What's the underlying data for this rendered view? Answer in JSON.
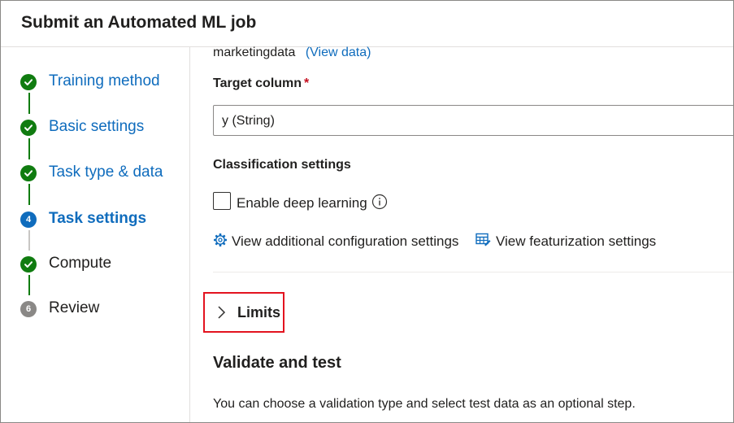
{
  "header": {
    "title": "Submit an Automated ML job"
  },
  "wizard": {
    "steps": [
      {
        "label": "Training method",
        "status": "done"
      },
      {
        "label": "Basic settings",
        "status": "done"
      },
      {
        "label": "Task type & data",
        "status": "done"
      },
      {
        "label": "Task settings",
        "status": "current",
        "number": "4"
      },
      {
        "label": "Compute",
        "status": "done"
      },
      {
        "label": "Review",
        "status": "pending",
        "number": "6"
      }
    ]
  },
  "main": {
    "dataset_name": "marketingdata",
    "view_data_link": "(View data)",
    "target_column": {
      "label": "Target column",
      "required_mark": "*",
      "value": "y (String)"
    },
    "classification": {
      "title": "Classification settings",
      "deep_learning_label": "Enable deep learning",
      "deep_learning_checked": false
    },
    "links": {
      "additional_config": "View additional configuration settings",
      "featurization": "View featurization settings"
    },
    "limits_label": "Limits",
    "validate": {
      "title": "Validate and test",
      "description": "You can choose a validation type and select test data as an optional step."
    }
  },
  "colors": {
    "accent": "#0f6cbd",
    "success": "#107c10",
    "pending": "#8a8886",
    "highlight": "#e3131f",
    "required": "#c50f1f"
  }
}
